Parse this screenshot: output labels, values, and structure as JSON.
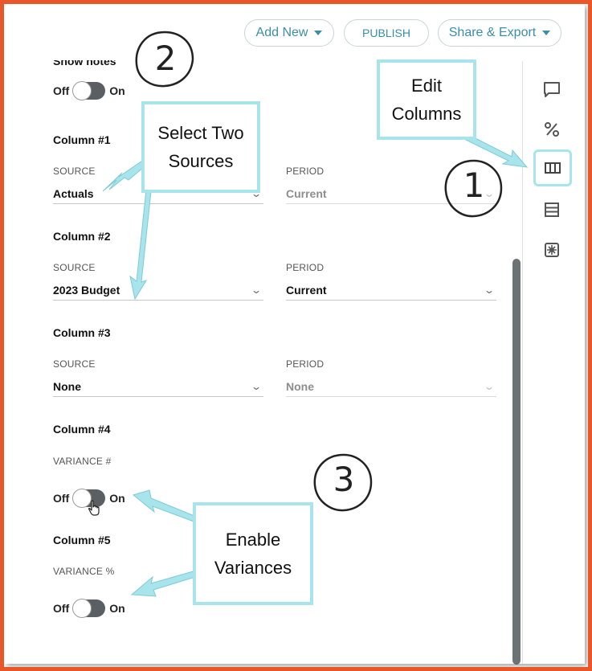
{
  "toolbar": {
    "add_new": "Add New",
    "publish": "PUBLISH",
    "share_export": "Share & Export"
  },
  "show_notes": {
    "title": "Show notes",
    "off": "Off",
    "on": "On"
  },
  "columns": [
    {
      "title": "Column #1",
      "source_label": "SOURCE",
      "source_value": "Actuals",
      "period_label": "PERIOD",
      "period_value": "Current",
      "period_disabled": true
    },
    {
      "title": "Column #2",
      "source_label": "SOURCE",
      "source_value": "2023 Budget",
      "period_label": "PERIOD",
      "period_value": "Current",
      "period_disabled": false
    },
    {
      "title": "Column #3",
      "source_label": "SOURCE",
      "source_value": "None",
      "period_label": "PERIOD",
      "period_value": "None",
      "period_disabled": true
    },
    {
      "title": "Column #4",
      "variance_label": "VARIANCE #",
      "off": "Off",
      "on": "On"
    },
    {
      "title": "Column #5",
      "variance_label": "VARIANCE %",
      "off": "Off",
      "on": "On"
    }
  ],
  "rail_icons": [
    "comment-icon",
    "percent-icon",
    "columns-icon",
    "rows-icon",
    "settings-icon"
  ],
  "annotations": {
    "select_two_sources": "Select Two Sources",
    "edit_columns": "Edit Columns",
    "enable_variances": "Enable Variances",
    "step1": "1",
    "step2": "2",
    "step3": "3"
  },
  "colors": {
    "frame": "#e8562a",
    "accent": "#3a8ea6",
    "callout_border": "#a8e4ec",
    "toggle": "#5a5f63"
  }
}
